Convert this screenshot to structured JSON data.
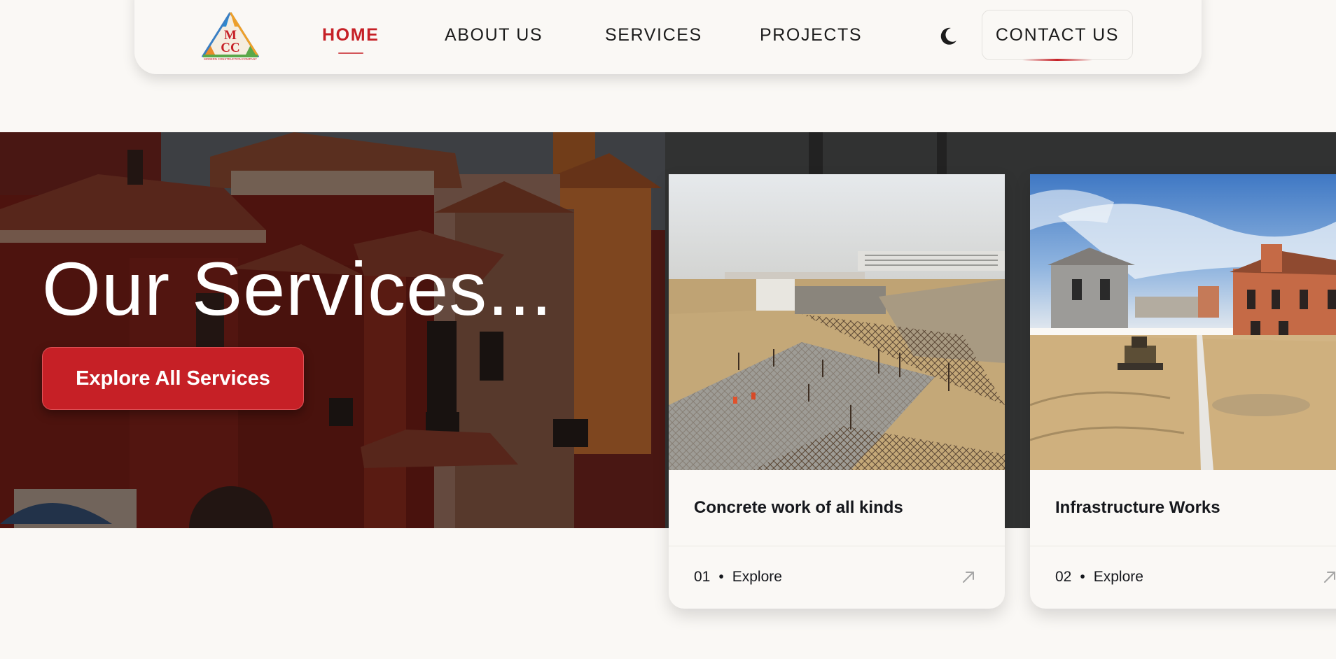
{
  "nav": {
    "logo_text": "MCC",
    "logo_caption": "MODERN CONSTRUCTION COMPANY",
    "links": [
      {
        "label": "HOME",
        "active": true
      },
      {
        "label": "ABOUT US",
        "active": false
      },
      {
        "label": "SERVICES",
        "active": false
      },
      {
        "label": "PROJECTS",
        "active": false
      }
    ],
    "theme_icon": "moon-icon",
    "contact_label": "CONTACT US"
  },
  "hero": {
    "title": "Our Services...",
    "cta_label": "Explore All Services"
  },
  "cards": [
    {
      "title": "Concrete work of all kinds",
      "number": "01",
      "separator": "•",
      "action": "Explore",
      "icon": "arrow-up-right-icon"
    },
    {
      "title": "Infrastructure Works",
      "number": "02",
      "separator": "•",
      "action": "Explore",
      "icon": "arrow-up-right-icon"
    }
  ],
  "colors": {
    "accent": "#c62026",
    "background": "#faf8f5",
    "text": "#1c1c1c"
  }
}
